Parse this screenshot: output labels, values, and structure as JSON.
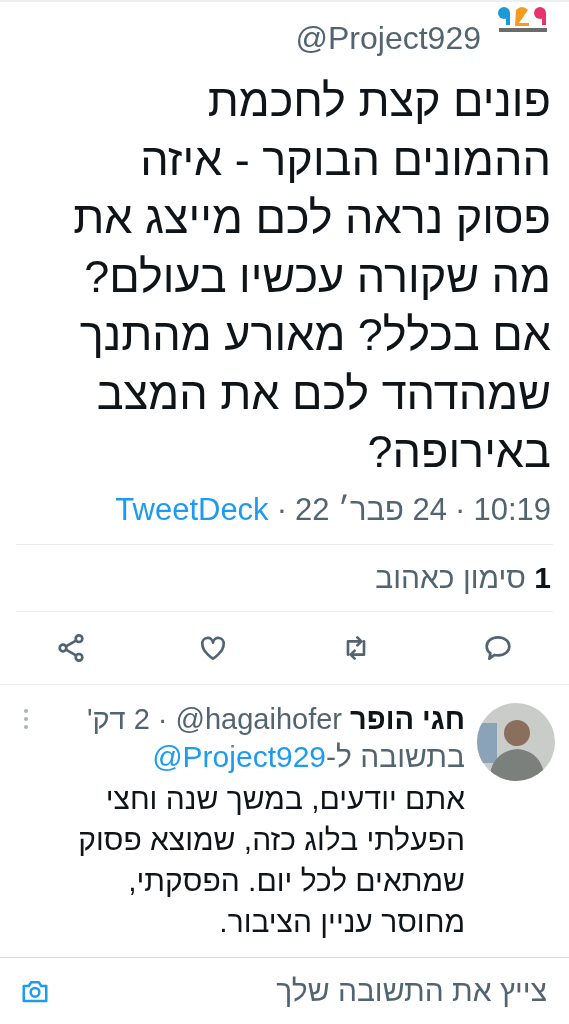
{
  "tweet": {
    "handle": "@Project929",
    "text_lines": [
      "פונים קצת לחכמת",
      "ההמונים הבוקר - איזה",
      "פסוק נראה לכם מייצג את",
      "מה שקורה עכשיו בעולם?",
      "אם בכלל? מאורע מהתנך",
      "שמהדהד לכם את המצב",
      "באירופה?"
    ],
    "time": "10:19",
    "date": "24 פבר׳ 22",
    "source": "TweetDeck",
    "separator": "·",
    "likes_count": "1",
    "likes_label": "סימון כאהוב"
  },
  "reply": {
    "name": "חגי הופר",
    "handle": "@hagaihofer",
    "separator": "·",
    "age": "2 דק'",
    "reply_to_label": "בתשובה ל-",
    "reply_to_handle": "@Project929",
    "text_lines": [
      "אתם יודעים, במשך שנה וחצי",
      "הפעלתי בלוג כזה, שמוצא פסוק",
      "שמתאים לכל יום. הפסקתי,",
      "מחוסר עניין הציבור."
    ]
  },
  "composer": {
    "placeholder": "צייץ את התשובה שלך"
  }
}
